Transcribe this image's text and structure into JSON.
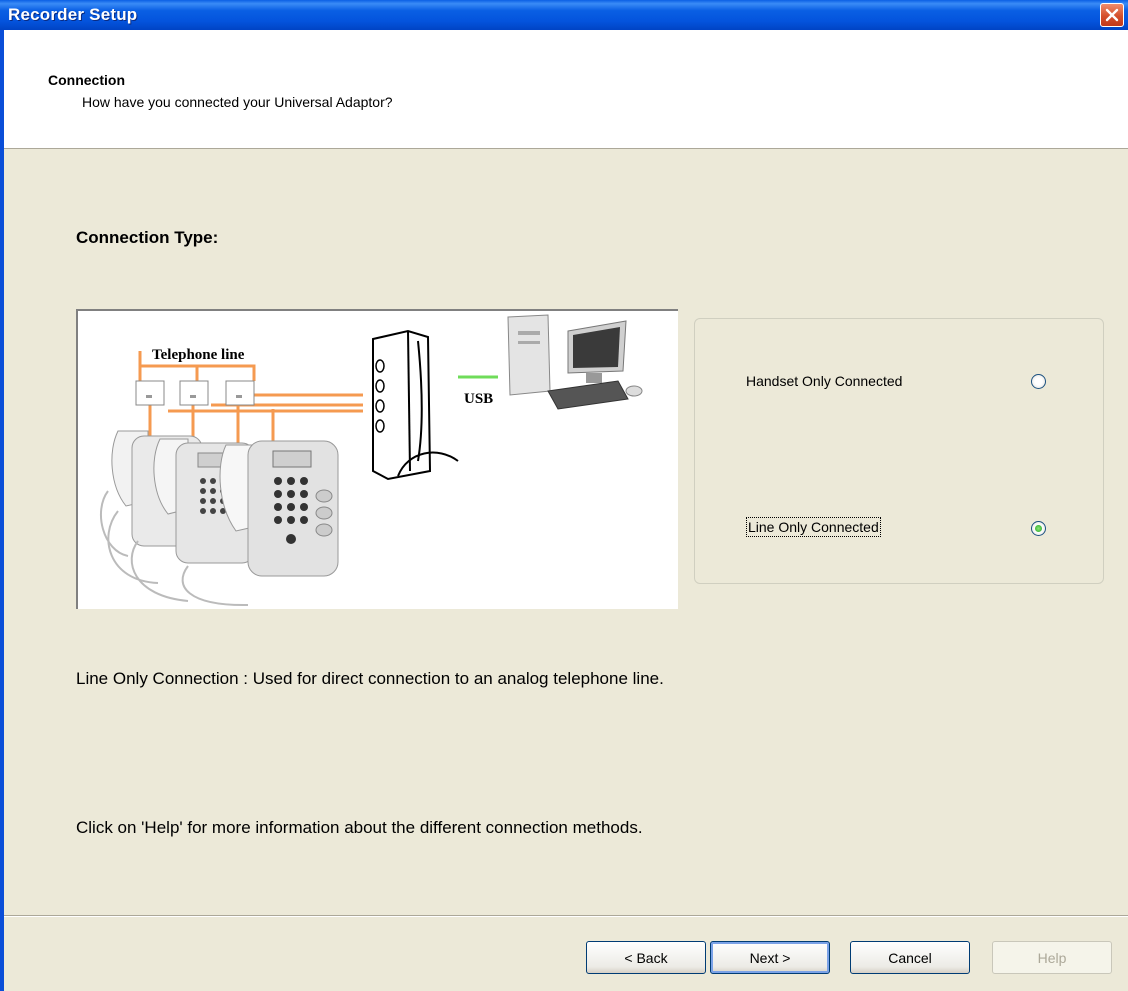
{
  "window": {
    "title": "Recorder Setup"
  },
  "header": {
    "title": "Connection",
    "subtitle": "How have you connected your Universal Adaptor?"
  },
  "main": {
    "connection_type_label": "Connection Type:",
    "diagram": {
      "telephone_line_label": "Telephone line",
      "usb_label": "USB"
    },
    "options": [
      {
        "label": "Handset Only Connected",
        "checked": false
      },
      {
        "label": "Line Only Connected",
        "checked": true
      }
    ],
    "description": "Line Only Connection : Used for direct connection to an analog telephone line.",
    "help_text": "Click on 'Help' for more information about the different connection methods."
  },
  "buttons": {
    "back": "< Back",
    "next": "Next >",
    "cancel": "Cancel",
    "help": "Help"
  },
  "colors": {
    "title_bar": "#0a5fe4",
    "dialog_bg": "#ece9d8",
    "line_wire": "#f59a50",
    "usb_wire": "#6fdc5a"
  }
}
